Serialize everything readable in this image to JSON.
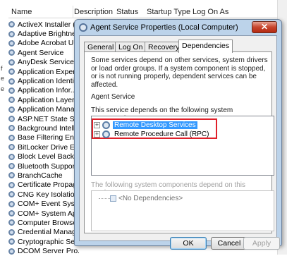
{
  "background": {
    "columns": [
      "Name",
      "Description",
      "Status",
      "Startup Type",
      "Log On As"
    ],
    "left_glyphs": [
      "f",
      "e",
      "e"
    ],
    "services": [
      {
        "name": "ActiveX Installer (..."
      },
      {
        "name": "Adaptive Brightness"
      },
      {
        "name": "Adobe Acrobat U..."
      },
      {
        "name": "Agent Service"
      },
      {
        "name": "AnyDesk Service"
      },
      {
        "name": "Application Experi..."
      },
      {
        "name": "Application Identity"
      },
      {
        "name": "Application Infor..."
      },
      {
        "name": "Application Layer ..."
      },
      {
        "name": "Application Mana..."
      },
      {
        "name": "ASP.NET State Ser..."
      },
      {
        "name": "Background Intelli..."
      },
      {
        "name": "Base Filtering Engi..."
      },
      {
        "name": "BitLocker Drive En..."
      },
      {
        "name": "Block Level Backu..."
      },
      {
        "name": "Bluetooth Support..."
      },
      {
        "name": "BranchCache"
      },
      {
        "name": "Certificate Propag..."
      },
      {
        "name": "CNG Key Isolation"
      },
      {
        "name": "COM+ Event Syst..."
      },
      {
        "name": "COM+ System Ap..."
      },
      {
        "name": "Computer Browser"
      },
      {
        "name": "Credential Manager"
      },
      {
        "name": "Cryptographic Ser..."
      },
      {
        "name": "DCOM Server Pro..."
      }
    ]
  },
  "dialog": {
    "title": "Agent Service Properties (Local Computer)",
    "close_glyph": "✕",
    "tabs": [
      "General",
      "Log On",
      "Recovery",
      "Dependencies"
    ],
    "active_tab": "Dependencies",
    "description": "Some services depend on other services, system drivers or load order groups. If a system component is stopped, or is not running properly, dependent services can be affected.",
    "service_name": "Agent Service",
    "depends_on_label": "This service depends on the following system components:",
    "depends_on": [
      "Remote Desktop Services",
      "Remote Procedure Call (RPC)"
    ],
    "dependents_label": "The following system components depend on this service:",
    "dependents_empty": "<No Dependencies>",
    "buttons": {
      "ok": "OK",
      "cancel": "Cancel",
      "apply": "Apply"
    },
    "highlight_color": "#e0202a"
  }
}
